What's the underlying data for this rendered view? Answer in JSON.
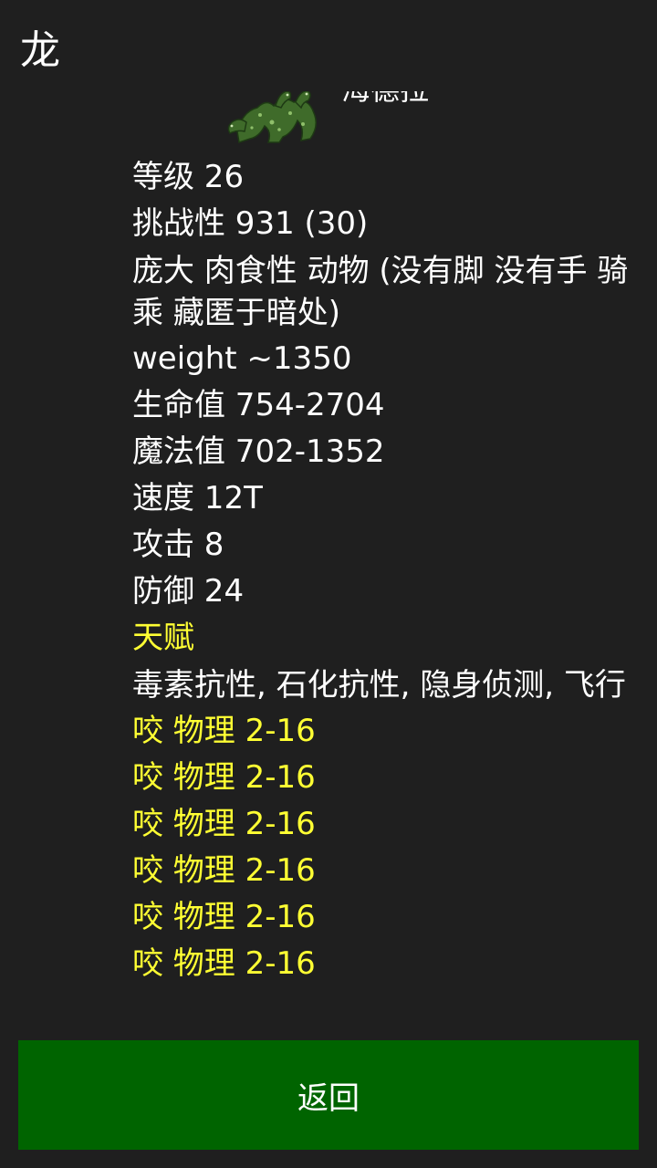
{
  "dialog": {
    "title": "龙"
  },
  "monster": {
    "name": "海德拉",
    "sprite_icon": "hydra-monster-sprite"
  },
  "stats": {
    "level": "等级 26",
    "challenge": "挑战性 931 (30)",
    "traits": "庞大 肉食性 动物 (没有脚 没有手 骑乘 藏匿于暗处)",
    "weight": "weight ~1350",
    "hp": "生命值 754-2704",
    "mp": "魔法值 702-1352",
    "speed": "速度 12T",
    "attack": "攻击 8",
    "defense": "防御 24",
    "talent_header": "天赋",
    "talents": "毒素抗性, 石化抗性, 隐身侦测, 飞行",
    "attacks": [
      "咬 物理 2-16",
      "咬 物理 2-16",
      "咬 物理 2-16",
      "咬 物理 2-16",
      "咬 物理 2-16",
      "咬 物理 2-16"
    ]
  },
  "actions": {
    "back_label": "返回"
  },
  "colors": {
    "background": "#1f1f1f",
    "highlight_text": "#ffff33",
    "button_green": "#006400"
  }
}
